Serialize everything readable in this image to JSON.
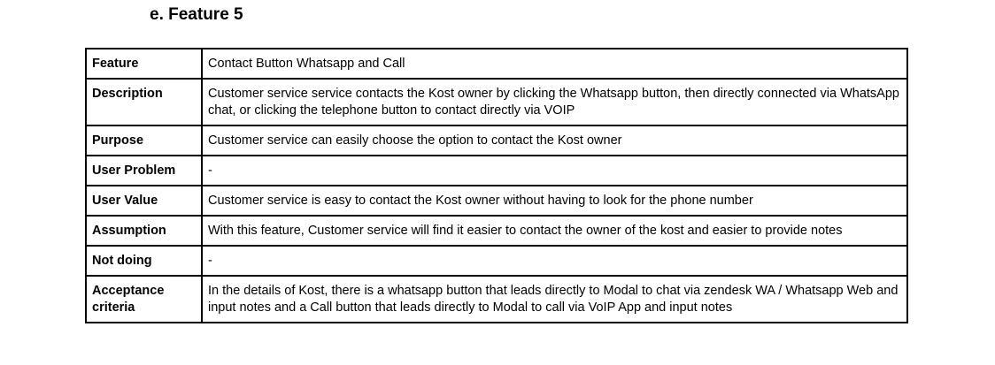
{
  "heading": "e. Feature 5",
  "rows": [
    {
      "label": "Feature",
      "value": "Contact Button Whatsapp and Call"
    },
    {
      "label": "Description",
      "value": "Customer service service contacts the Kost owner by clicking the Whatsapp button, then directly connected via WhatsApp chat, or clicking the telephone button to contact directly via VOIP"
    },
    {
      "label": "Purpose",
      "value": "Customer service can easily choose the option to contact the Kost owner"
    },
    {
      "label": "User Problem",
      "value": "-"
    },
    {
      "label": "User Value",
      "value": "Customer service is easy to contact the Kost owner without having to look for the phone number"
    },
    {
      "label": "Assumption",
      "value": "With this feature, Customer service will find it easier to contact the owner of the kost and easier to provide notes"
    },
    {
      "label": "Not doing",
      "value": "-"
    },
    {
      "label": "Acceptance criteria",
      "value": "In the details of Kost, there is a whatsapp button that leads directly to Modal to chat via zendesk WA / Whatsapp Web and input notes and a Call button that leads directly to Modal to call via VoIP App and input notes"
    }
  ]
}
